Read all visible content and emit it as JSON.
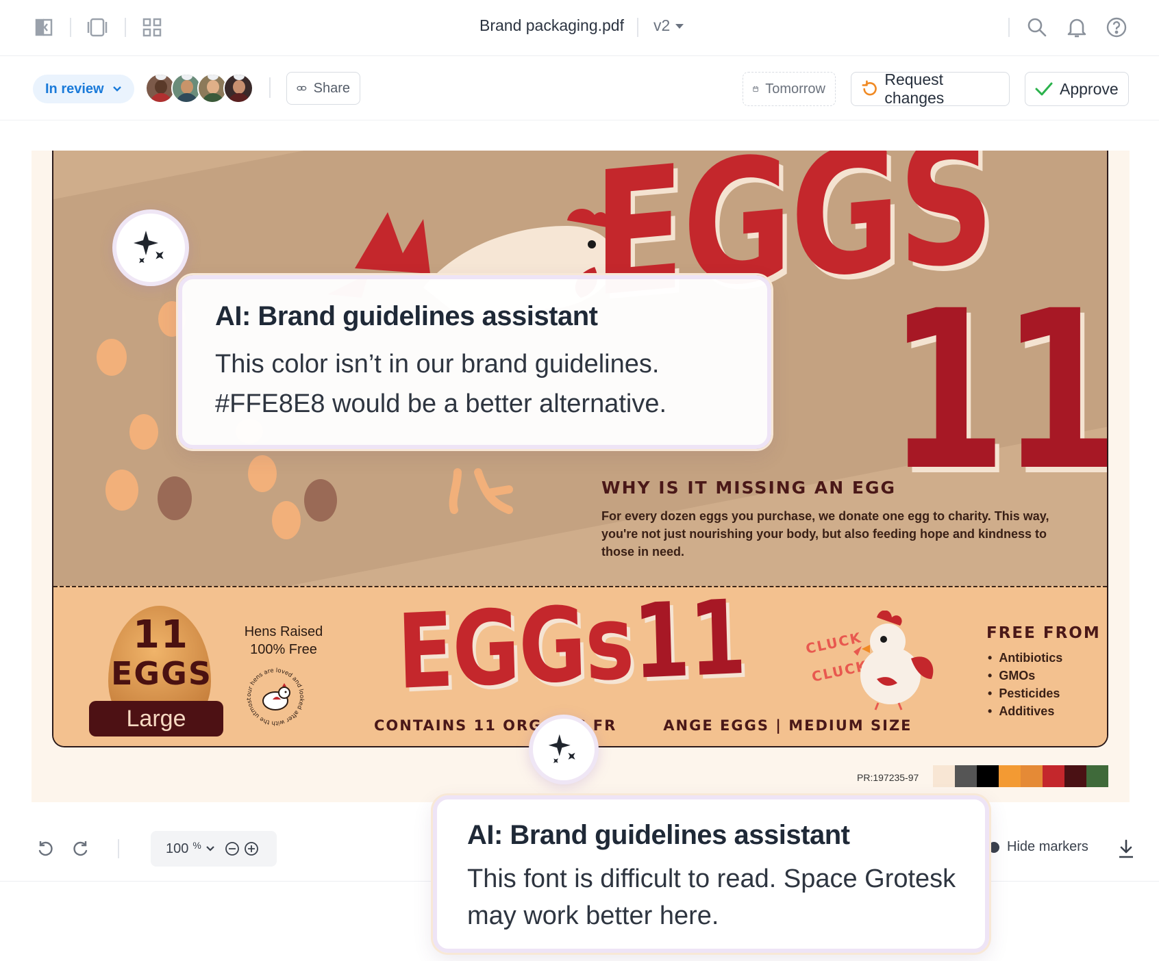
{
  "header": {
    "doc_title": "Brand packaging.pdf",
    "version": "v2"
  },
  "review": {
    "status": "In review",
    "share_label": "Share",
    "due_label": "Tomorrow",
    "request_changes_label": "Request changes",
    "approve_label": "Approve"
  },
  "artwork": {
    "big_word": "EGGS",
    "big_number": "11",
    "missing_title": "WHY IS IT MISSING AN EGG",
    "missing_body": "For every dozen eggs you purchase, we donate one egg to charity. This way, you're not just nourishing your body, but also feeding hope and kindness to those in need.",
    "size_number": "11",
    "size_eggs": "EGGS",
    "size_label": "Large",
    "hens_line1": "Hens Raised",
    "hens_line2": "100% Free",
    "seal_text": "our hens are loved and looked after with the utmost care",
    "logo_word": "EGGs",
    "logo_number": "11",
    "contains_left": "CONTAINS 11 ORGANIC FR",
    "contains_right": "ANGE EGGS | MEDIUM SIZE",
    "cluck1": "CLUCK",
    "cluck2": "CLUCK",
    "free_title": "FREE FROM",
    "free_items": [
      "Antibiotics",
      "GMOs",
      "Pesticides",
      "Additives"
    ],
    "pr_code": "PR:197235-97",
    "swatches": [
      "#f8e6d4",
      "#555555",
      "#000000",
      "#f39a33",
      "#e58a36",
      "#c4272c",
      "#4a1114",
      "#3f6a3a"
    ]
  },
  "ai": {
    "card1": {
      "title": "AI: Brand guidelines assistant",
      "line1": "This color isn’t in our brand guidelines.",
      "line2": "#FFE8E8 would be a better alternative."
    },
    "card2": {
      "title": "AI: Brand guidelines assistant",
      "line1": "This font is difficult to read. Space Grotesk",
      "line2": "may work better here."
    }
  },
  "toolbar": {
    "zoom_value": "100",
    "zoom_unit": "%",
    "hide_markers_label": "Hide markers"
  },
  "colors": {
    "accent_blue": "#1a7ad9",
    "approve_green": "#2bb24c",
    "request_orange": "#f08a24",
    "brand_red": "#c4272c",
    "brand_dark_red": "#a71825"
  }
}
